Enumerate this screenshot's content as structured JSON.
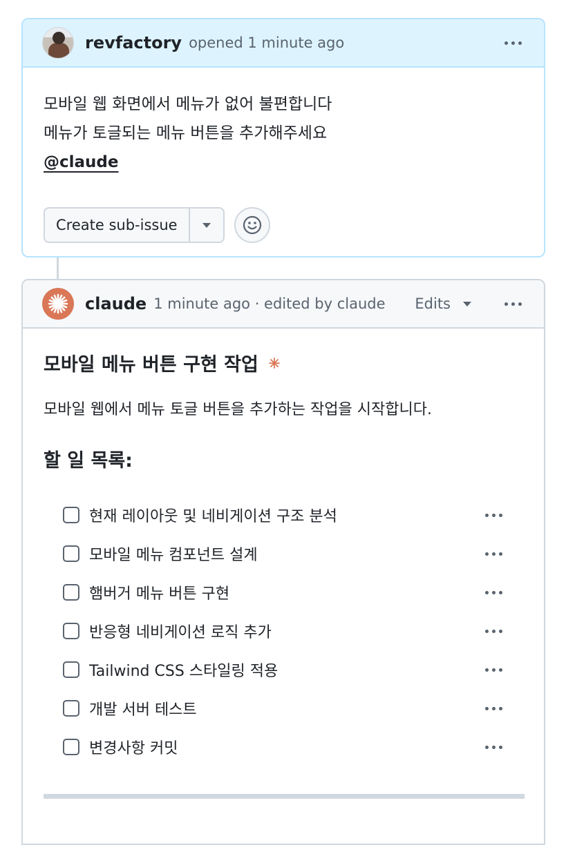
{
  "issue": {
    "author": "revfactory",
    "meta": "opened 1 minute ago",
    "body_lines": [
      "모바일 웹 화면에서 메뉴가 없어 불편합니다",
      "메뉴가 토글되는 메뉴 버튼을 추가해주세요"
    ],
    "mention": "@claude",
    "create_sub_issue_label": "Create sub-issue",
    "icons": {
      "avatar": "user-photo-avatar",
      "menu": "kebab-horizontal-icon",
      "dropdown": "triangle-down-icon",
      "reaction": "smiley-icon"
    }
  },
  "comment": {
    "author": "claude",
    "meta": "1 minute ago · edited by claude",
    "edits_label": "Edits",
    "title": "모바일 메뉴 버튼 구현 작업",
    "description": "모바일 웹에서 메뉴 토글 버튼을 추가하는 작업을 시작합니다.",
    "todo_heading": "할 일 목록:",
    "todos": [
      {
        "label": "현재 레이아웃 및 네비게이션 구조 분석",
        "checked": false
      },
      {
        "label": "모바일 메뉴 컴포넌트 설계",
        "checked": false
      },
      {
        "label": "햄버거 메뉴 버튼 구현",
        "checked": false
      },
      {
        "label": "반응형 네비게이션 로직 추가",
        "checked": false
      },
      {
        "label": "Tailwind CSS 스타일링 적용",
        "checked": false
      },
      {
        "label": "개발 서버 테스트",
        "checked": false
      },
      {
        "label": "변경사항 커밋",
        "checked": false
      }
    ],
    "icons": {
      "avatar": "claude-spark-avatar",
      "title_mark": "claude-spark-icon",
      "menu": "kebab-horizontal-icon"
    }
  },
  "colors": {
    "accent_header": "#ddf4ff",
    "claude_brand": "#d97757",
    "border": "#d0d7de",
    "muted_text": "#59636e"
  }
}
